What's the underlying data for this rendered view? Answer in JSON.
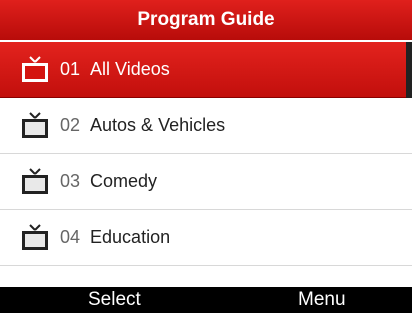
{
  "header": {
    "title": "Program Guide"
  },
  "items": [
    {
      "num": "01",
      "label": "All Videos"
    },
    {
      "num": "02",
      "label": "Autos & Vehicles"
    },
    {
      "num": "03",
      "label": "Comedy"
    },
    {
      "num": "04",
      "label": "Education"
    }
  ],
  "softkeys": {
    "left": "Select",
    "right": "Menu"
  },
  "colors": {
    "accent": "#d4140f",
    "softbar": "#000000"
  },
  "icons": {
    "item_icon": "tv-icon"
  }
}
